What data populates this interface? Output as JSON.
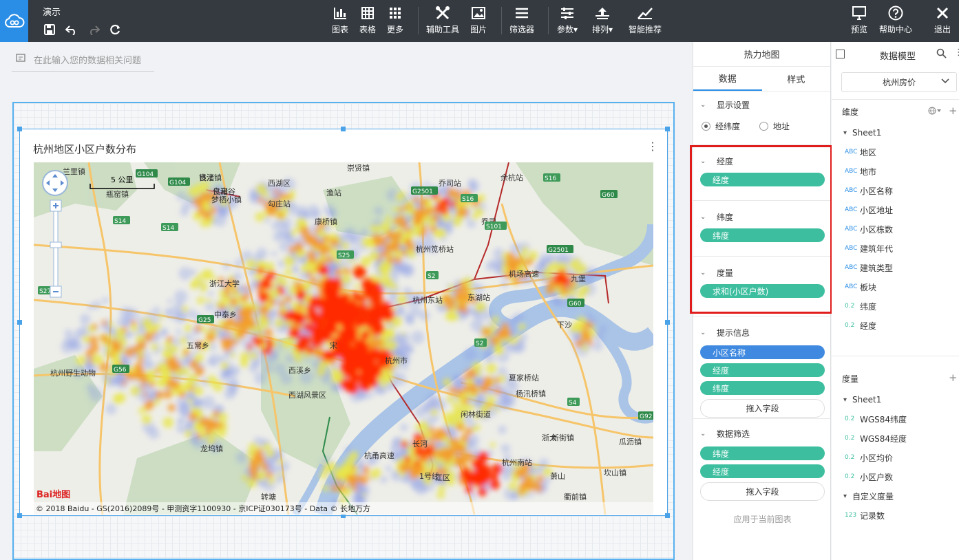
{
  "app": {
    "title": "演示"
  },
  "toolbar": {
    "chart": "图表",
    "table": "表格",
    "more": "更多",
    "assist": "辅助工具",
    "image": "图片",
    "filter": "筛选器",
    "params": "参数",
    "sort": "排列",
    "smart": "智能推荐",
    "preview": "预览",
    "help": "帮助中心",
    "exit": "退出"
  },
  "ask": {
    "placeholder": "在此输入您的数据相关问题"
  },
  "card": {
    "title": "杭州地区小区户数分布"
  },
  "map": {
    "scale_label": "5 公里",
    "copyright": "© 2018 Baidu - GS(2016)2089号 - 甲测资字1100930 - 京ICP证030173号 - Data © 长地万方",
    "logo": "Bai地图",
    "places": [
      "良渚镇",
      "良渚谷",
      "梦栖小镇",
      "勾庄站",
      "康桥镇",
      "崇贤镇",
      "乔司站",
      "余杭站",
      "乔司",
      "杭州笕桥站",
      "瓶窑镇",
      "浙江大学",
      "杭州东站",
      "五常乡",
      "西溪乡",
      "西湖风景区",
      "杭州市",
      "九堡",
      "下沙",
      "龙坞镇",
      "转塘",
      "杭州野生动物",
      "中泰乡",
      "闲林街道",
      "浙大",
      "杭州南站",
      "新街镇",
      "瓜沥镇",
      "坎山镇",
      "衢前镇",
      "杨汛桥镇",
      "夏家桥站",
      "机场高速",
      "杭甬高速",
      "1号线",
      "长河",
      "萧山",
      "江区",
      "兰里镇",
      "宋",
      "东湖站",
      "渔站",
      "西湖区",
      "钱江",
      "仁和"
    ],
    "roads": [
      "G104",
      "G104",
      "S14",
      "S14",
      "G2501",
      "S16",
      "S16",
      "G60",
      "G2501",
      "S101",
      "S2",
      "S2",
      "G60",
      "G25",
      "G56",
      "S4",
      "G92",
      "S25",
      "S27"
    ]
  },
  "config": {
    "panel_title": "热力地图",
    "tab_data": "数据",
    "tab_style": "样式",
    "display": {
      "title": "显示设置",
      "opt_lnglat": "经纬度",
      "opt_addr": "地址",
      "selected": "经纬度"
    },
    "lng": {
      "title": "经度",
      "pill": "经度"
    },
    "lat": {
      "title": "纬度",
      "pill": "纬度"
    },
    "measure": {
      "title": "度量",
      "pill": "求和(小区户数)"
    },
    "tip": {
      "title": "提示信息",
      "pills": [
        "小区名称",
        "经度",
        "纬度"
      ],
      "drop": "拖入字段"
    },
    "filter": {
      "title": "数据筛选",
      "pills": [
        "纬度",
        "经度"
      ],
      "drop": "拖入字段",
      "apply": "应用于当前图表"
    }
  },
  "model": {
    "title": "数据模型",
    "dataset": "杭州房价",
    "dim_title": "维度",
    "dim_group": "Sheet1",
    "dims": [
      {
        "t": "ABC",
        "n": "地区"
      },
      {
        "t": "ABC",
        "n": "地市"
      },
      {
        "t": "ABC",
        "n": "小区名称"
      },
      {
        "t": "ABC",
        "n": "小区地址"
      },
      {
        "t": "ABC",
        "n": "小区栋数"
      },
      {
        "t": "ABC",
        "n": "建筑年代"
      },
      {
        "t": "ABC",
        "n": "建筑类型"
      },
      {
        "t": "ABC",
        "n": "板块"
      },
      {
        "t": "0.2",
        "n": "纬度"
      },
      {
        "t": "0.2",
        "n": "经度"
      }
    ],
    "meas_title": "度量",
    "meas_group": "Sheet1",
    "meas": [
      {
        "t": "0.2",
        "n": "WGS84纬度"
      },
      {
        "t": "0.2",
        "n": "WGS84经度"
      },
      {
        "t": "0.2",
        "n": "小区均价"
      },
      {
        "t": "0.2",
        "n": "小区户数"
      }
    ],
    "custom_group": "自定义度量",
    "custom": [
      {
        "t": "123",
        "n": "记录数"
      }
    ]
  }
}
